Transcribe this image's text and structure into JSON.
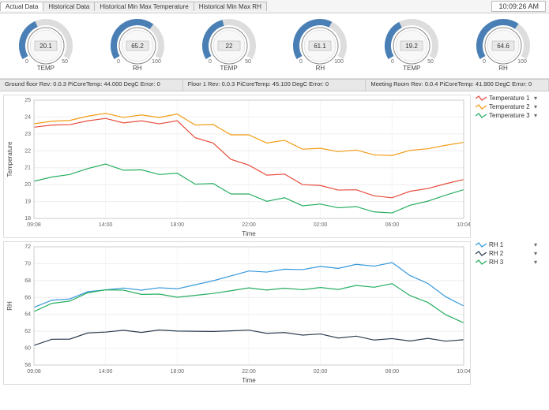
{
  "clock": "10:09:26 AM",
  "tabs": {
    "items": [
      {
        "label": "Actual Data",
        "active": true
      },
      {
        "label": "Historical Data",
        "active": false
      },
      {
        "label": "Historical Min Max Temperature",
        "active": false
      },
      {
        "label": "Historical Min Max RH",
        "active": false
      }
    ]
  },
  "gauges": [
    {
      "value": "20.1",
      "unit": "TEMP",
      "min": "0",
      "max": "50",
      "frac": 0.402
    },
    {
      "value": "65.2",
      "unit": "RH",
      "min": "0",
      "max": "100",
      "frac": 0.652
    },
    {
      "value": "22",
      "unit": "TEMP",
      "min": "0",
      "max": "50",
      "frac": 0.44
    },
    {
      "value": "61.1",
      "unit": "RH",
      "min": "0",
      "max": "100",
      "frac": 0.611
    },
    {
      "value": "19.2",
      "unit": "TEMP",
      "min": "0",
      "max": "50",
      "frac": 0.384
    },
    {
      "value": "64.6",
      "unit": "RH",
      "min": "0",
      "max": "100",
      "frac": 0.646
    }
  ],
  "status": [
    "Ground floor Rev: 0.0.3 PiCoreTemp: 44.000 DegC Error: 0",
    "Floor 1 Rev: 0.0.3 PiCoreTemp: 45.100 DegC Error: 0",
    "Meeting Room Rev: 0.0.4 PiCoreTemp: 41.900 DegC Error: 0"
  ],
  "chart_data": [
    {
      "type": "line",
      "title": "",
      "xlabel": "Time",
      "ylabel": "Temperature",
      "ylim": [
        18,
        25
      ],
      "yticks": [
        18,
        19,
        20,
        21,
        22,
        23,
        24,
        25
      ],
      "categories": [
        "09:08",
        "14:00",
        "18:00",
        "22:00",
        "02:00",
        "06:00",
        "10:04"
      ],
      "series": [
        {
          "name": "Temperature 1",
          "color": "#e74c3c",
          "values": [
            23.4,
            23.8,
            23.6,
            21.0,
            19.9,
            19.3,
            20.3
          ]
        },
        {
          "name": "Temperature 2",
          "color": "#f39c12",
          "values": [
            23.6,
            24.1,
            24.0,
            22.8,
            22.1,
            21.8,
            22.5
          ]
        },
        {
          "name": "Temperature 3",
          "color": "#27ae60",
          "values": [
            20.2,
            21.1,
            20.5,
            19.3,
            18.8,
            18.4,
            19.7
          ]
        }
      ],
      "legend": [
        {
          "name": "Temperature 1",
          "color": "#e74c3c"
        },
        {
          "name": "Temperature 2",
          "color": "#f39c12"
        },
        {
          "name": "Temperature 3",
          "color": "#27ae60"
        }
      ]
    },
    {
      "type": "line",
      "title": "",
      "xlabel": "Time",
      "ylabel": "RH",
      "ylim": [
        58,
        72
      ],
      "yticks": [
        58,
        60,
        62,
        64,
        66,
        68,
        70,
        72
      ],
      "categories": [
        "09:08",
        "14:00",
        "18:00",
        "22:00",
        "02:00",
        "06:00",
        "10:04"
      ],
      "series": [
        {
          "name": "RH 1",
          "color": "#3498db",
          "values": [
            65,
            67,
            67,
            69,
            69.5,
            70,
            65
          ]
        },
        {
          "name": "RH 2",
          "color": "#2c3e50",
          "values": [
            60.5,
            62,
            62,
            62,
            61.5,
            61,
            61
          ]
        },
        {
          "name": "RH 3",
          "color": "#27ae60",
          "values": [
            64.5,
            67,
            66,
            67,
            67,
            67.5,
            63
          ]
        }
      ],
      "legend": [
        {
          "name": "RH 1",
          "color": "#3498db"
        },
        {
          "name": "RH 2",
          "color": "#2c3e50"
        },
        {
          "name": "RH 3",
          "color": "#27ae60"
        }
      ]
    }
  ]
}
